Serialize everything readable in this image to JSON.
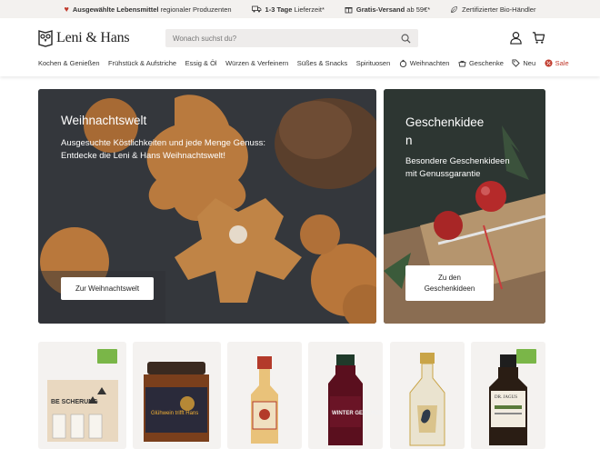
{
  "topbar": {
    "items": [
      {
        "icon": "heart-icon",
        "bold": "Ausgewählte Lebensmittel",
        "rest": " regionaler Produzenten"
      },
      {
        "icon": "truck-icon",
        "bold": "1-3 Tage",
        "rest": " Lieferzeit*"
      },
      {
        "icon": "gift-icon",
        "bold": "Gratis-Versand",
        "rest": " ab 59€*"
      },
      {
        "icon": "leaf-icon",
        "bold": "",
        "rest": "Zertifizierter Bio-Händler"
      }
    ]
  },
  "header": {
    "logo_text": "Leni & Hans",
    "search_placeholder": "Wonach suchst du?",
    "nav": [
      {
        "label": "Kochen & Genießen",
        "icon": ""
      },
      {
        "label": "Frühstück & Aufstriche",
        "icon": ""
      },
      {
        "label": "Essig & Öl",
        "icon": ""
      },
      {
        "label": "Würzen & Verfeinern",
        "icon": ""
      },
      {
        "label": "Süßes & Snacks",
        "icon": ""
      },
      {
        "label": "Spirituosen",
        "icon": ""
      },
      {
        "label": "Weihnachten",
        "icon": "ornament-icon"
      },
      {
        "label": "Geschenke",
        "icon": "gift-box-icon"
      },
      {
        "label": "Neu",
        "icon": "tag-icon"
      },
      {
        "label": "Sale",
        "icon": "percent-icon"
      }
    ]
  },
  "hero": {
    "main": {
      "title": "Weihnachtswelt",
      "text": "Ausgesuchte Köstlichkeiten und jede Menge Genuss: Entdecke die Leni & Hans Weihnachtswelt!",
      "button": "Zur Weihnachtswelt"
    },
    "side": {
      "title_line1": "Geschenkidee",
      "title_line2": "n",
      "text": "Besondere Geschenkideen mit Genussgarantie",
      "button_line1": "Zu den",
      "button_line2": "Geschenkideen"
    }
  },
  "products": {
    "items": [
      {
        "name": "gift-set-product",
        "label": "BE SCHERUNG",
        "bio": true
      },
      {
        "name": "chutney-jar-product",
        "label": "Glühwein trifft Hans",
        "bio": false
      },
      {
        "name": "punch-bottle-product",
        "label": "",
        "bio": false
      },
      {
        "name": "winter-spice-bottle-product",
        "label": "WINTER GEWÜRZE",
        "bio": false
      },
      {
        "name": "gin-bottle-product",
        "label": "",
        "bio": false
      },
      {
        "name": "herbal-liqueur-product",
        "label": "DR. JAGUS",
        "bio": true
      }
    ]
  },
  "colors": {
    "accent_red": "#c0392b",
    "bio_green": "#7ab648",
    "topbar_bg": "#f3f1ef"
  }
}
